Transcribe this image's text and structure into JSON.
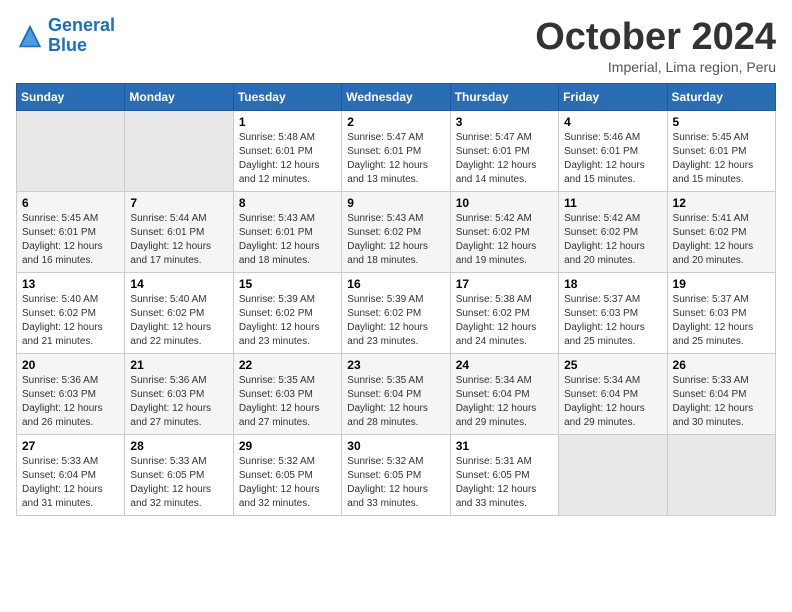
{
  "header": {
    "logo_line1": "General",
    "logo_line2": "Blue",
    "month": "October 2024",
    "location": "Imperial, Lima region, Peru"
  },
  "weekdays": [
    "Sunday",
    "Monday",
    "Tuesday",
    "Wednesday",
    "Thursday",
    "Friday",
    "Saturday"
  ],
  "weeks": [
    [
      {
        "day": "",
        "empty": true
      },
      {
        "day": "",
        "empty": true
      },
      {
        "day": "1",
        "sunrise": "5:48 AM",
        "sunset": "6:01 PM",
        "daylight": "12 hours and 12 minutes."
      },
      {
        "day": "2",
        "sunrise": "5:47 AM",
        "sunset": "6:01 PM",
        "daylight": "12 hours and 13 minutes."
      },
      {
        "day": "3",
        "sunrise": "5:47 AM",
        "sunset": "6:01 PM",
        "daylight": "12 hours and 14 minutes."
      },
      {
        "day": "4",
        "sunrise": "5:46 AM",
        "sunset": "6:01 PM",
        "daylight": "12 hours and 15 minutes."
      },
      {
        "day": "5",
        "sunrise": "5:45 AM",
        "sunset": "6:01 PM",
        "daylight": "12 hours and 15 minutes."
      }
    ],
    [
      {
        "day": "6",
        "sunrise": "5:45 AM",
        "sunset": "6:01 PM",
        "daylight": "12 hours and 16 minutes."
      },
      {
        "day": "7",
        "sunrise": "5:44 AM",
        "sunset": "6:01 PM",
        "daylight": "12 hours and 17 minutes."
      },
      {
        "day": "8",
        "sunrise": "5:43 AM",
        "sunset": "6:01 PM",
        "daylight": "12 hours and 18 minutes."
      },
      {
        "day": "9",
        "sunrise": "5:43 AM",
        "sunset": "6:02 PM",
        "daylight": "12 hours and 18 minutes."
      },
      {
        "day": "10",
        "sunrise": "5:42 AM",
        "sunset": "6:02 PM",
        "daylight": "12 hours and 19 minutes."
      },
      {
        "day": "11",
        "sunrise": "5:42 AM",
        "sunset": "6:02 PM",
        "daylight": "12 hours and 20 minutes."
      },
      {
        "day": "12",
        "sunrise": "5:41 AM",
        "sunset": "6:02 PM",
        "daylight": "12 hours and 20 minutes."
      }
    ],
    [
      {
        "day": "13",
        "sunrise": "5:40 AM",
        "sunset": "6:02 PM",
        "daylight": "12 hours and 21 minutes."
      },
      {
        "day": "14",
        "sunrise": "5:40 AM",
        "sunset": "6:02 PM",
        "daylight": "12 hours and 22 minutes."
      },
      {
        "day": "15",
        "sunrise": "5:39 AM",
        "sunset": "6:02 PM",
        "daylight": "12 hours and 23 minutes."
      },
      {
        "day": "16",
        "sunrise": "5:39 AM",
        "sunset": "6:02 PM",
        "daylight": "12 hours and 23 minutes."
      },
      {
        "day": "17",
        "sunrise": "5:38 AM",
        "sunset": "6:02 PM",
        "daylight": "12 hours and 24 minutes."
      },
      {
        "day": "18",
        "sunrise": "5:37 AM",
        "sunset": "6:03 PM",
        "daylight": "12 hours and 25 minutes."
      },
      {
        "day": "19",
        "sunrise": "5:37 AM",
        "sunset": "6:03 PM",
        "daylight": "12 hours and 25 minutes."
      }
    ],
    [
      {
        "day": "20",
        "sunrise": "5:36 AM",
        "sunset": "6:03 PM",
        "daylight": "12 hours and 26 minutes."
      },
      {
        "day": "21",
        "sunrise": "5:36 AM",
        "sunset": "6:03 PM",
        "daylight": "12 hours and 27 minutes."
      },
      {
        "day": "22",
        "sunrise": "5:35 AM",
        "sunset": "6:03 PM",
        "daylight": "12 hours and 27 minutes."
      },
      {
        "day": "23",
        "sunrise": "5:35 AM",
        "sunset": "6:04 PM",
        "daylight": "12 hours and 28 minutes."
      },
      {
        "day": "24",
        "sunrise": "5:34 AM",
        "sunset": "6:04 PM",
        "daylight": "12 hours and 29 minutes."
      },
      {
        "day": "25",
        "sunrise": "5:34 AM",
        "sunset": "6:04 PM",
        "daylight": "12 hours and 29 minutes."
      },
      {
        "day": "26",
        "sunrise": "5:33 AM",
        "sunset": "6:04 PM",
        "daylight": "12 hours and 30 minutes."
      }
    ],
    [
      {
        "day": "27",
        "sunrise": "5:33 AM",
        "sunset": "6:04 PM",
        "daylight": "12 hours and 31 minutes."
      },
      {
        "day": "28",
        "sunrise": "5:33 AM",
        "sunset": "6:05 PM",
        "daylight": "12 hours and 32 minutes."
      },
      {
        "day": "29",
        "sunrise": "5:32 AM",
        "sunset": "6:05 PM",
        "daylight": "12 hours and 32 minutes."
      },
      {
        "day": "30",
        "sunrise": "5:32 AM",
        "sunset": "6:05 PM",
        "daylight": "12 hours and 33 minutes."
      },
      {
        "day": "31",
        "sunrise": "5:31 AM",
        "sunset": "6:05 PM",
        "daylight": "12 hours and 33 minutes."
      },
      {
        "day": "",
        "empty": true
      },
      {
        "day": "",
        "empty": true
      }
    ]
  ],
  "labels": {
    "sunrise": "Sunrise:",
    "sunset": "Sunset:",
    "daylight": "Daylight: 12 hours"
  }
}
